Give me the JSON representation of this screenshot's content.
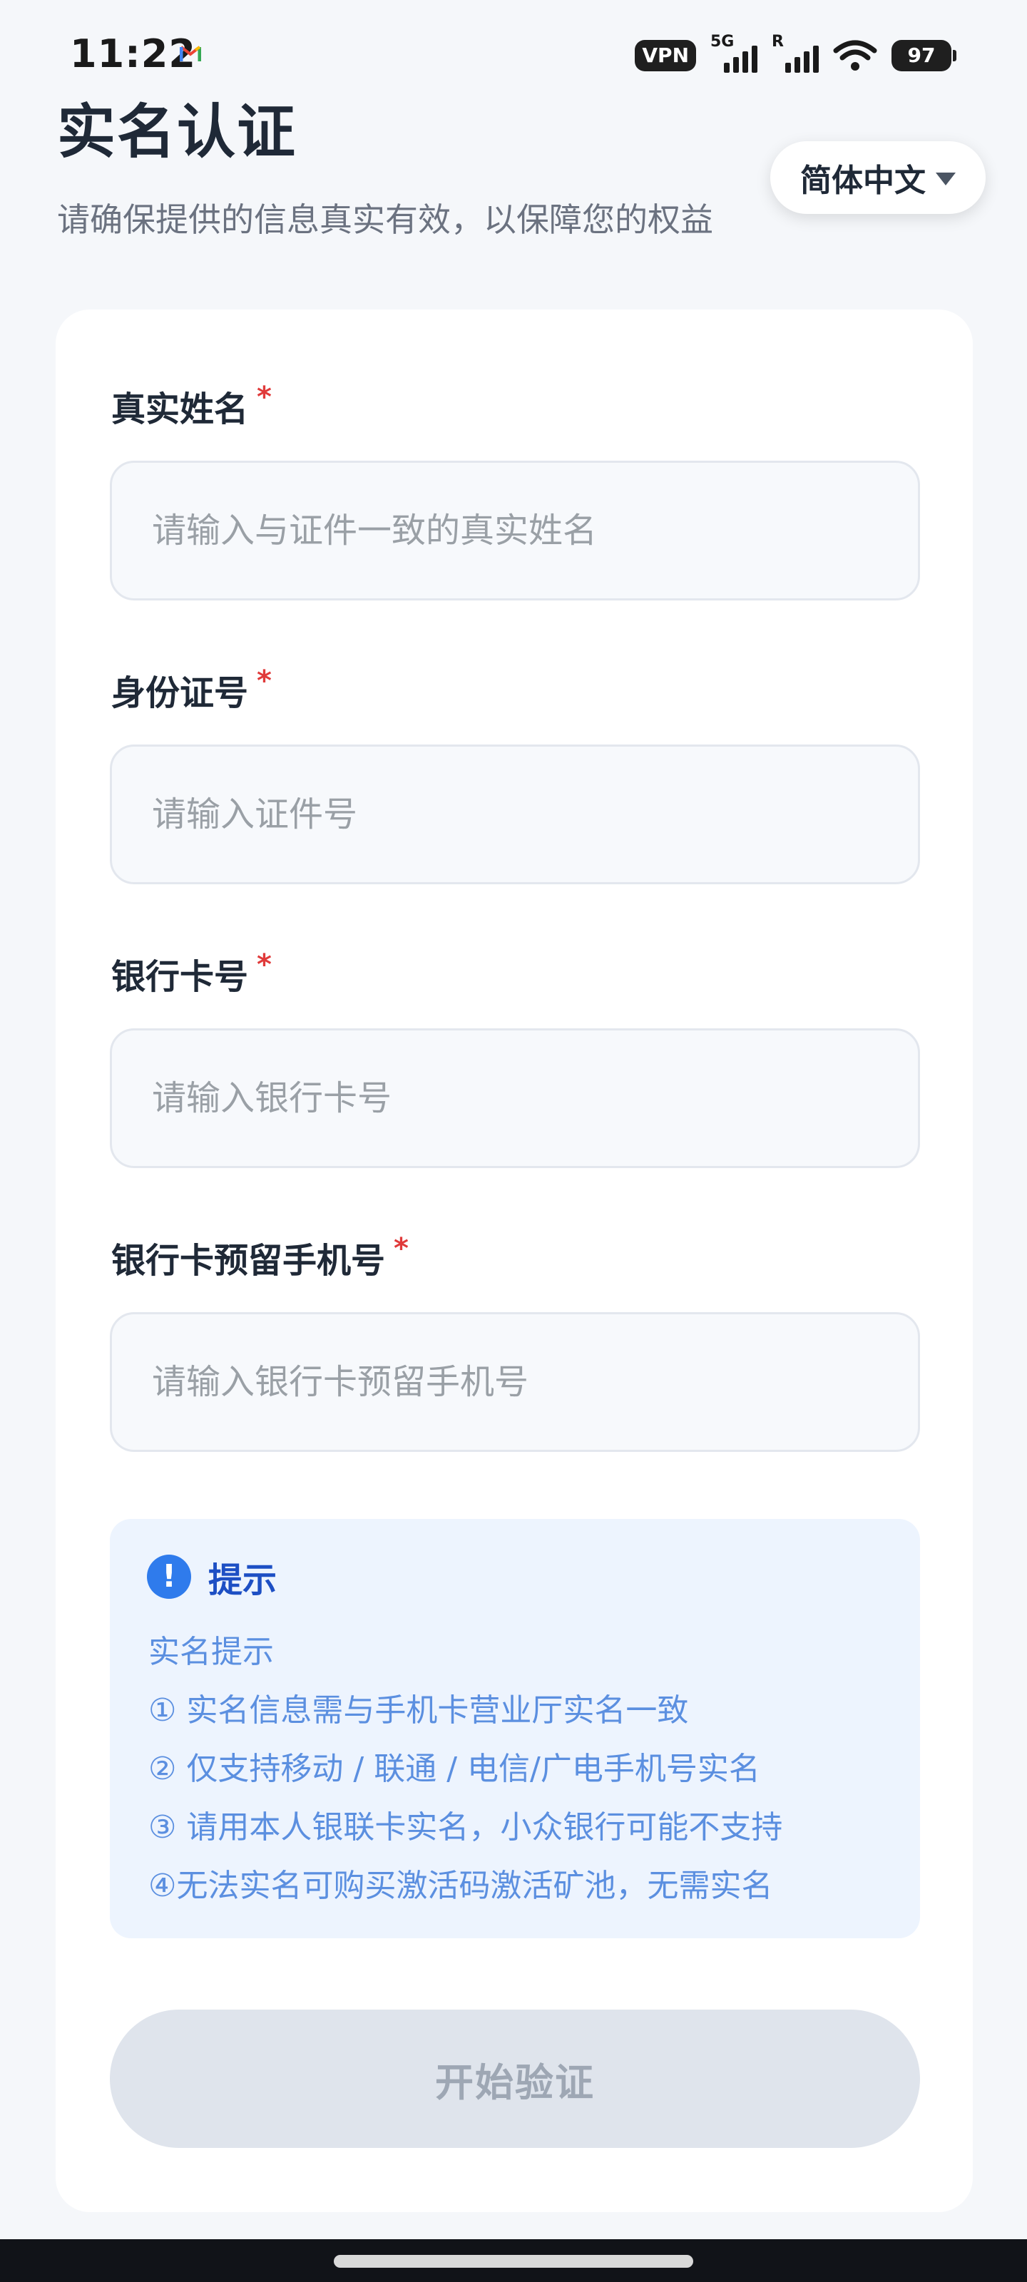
{
  "status_bar": {
    "time": "11:22",
    "vpn": "VPN",
    "signal1_tag": "5G",
    "signal2_tag": "R",
    "battery": "97"
  },
  "header": {
    "title": "实名认证",
    "subtitle": "请确保提供的信息真实有效，以保障您的权益",
    "language": "简体中文"
  },
  "form": {
    "required_mark": "*",
    "fields": [
      {
        "label": "真实姓名",
        "placeholder": "请输入与证件一致的真实姓名",
        "value": ""
      },
      {
        "label": "身份证号",
        "placeholder": "请输入证件号",
        "value": ""
      },
      {
        "label": "银行卡号",
        "placeholder": "请输入银行卡号",
        "value": ""
      },
      {
        "label": "银行卡预留手机号",
        "placeholder": "请输入银行卡预留手机号",
        "value": ""
      }
    ]
  },
  "tip": {
    "icon": "!",
    "title": "提示",
    "lines": [
      "实名提示",
      "① 实名信息需与手机卡营业厅实名一致",
      "② 仅支持移动 / 联通 / 电信/广电手机号实名",
      "③ 请用本人银联卡实名，小众银行可能不支持",
      "④无法实名可购买激活码激活矿池，无需实名"
    ]
  },
  "submit_label": "开始验证",
  "colors": {
    "background": "#f5f7fa",
    "card": "#ffffff",
    "required": "#e03a3a",
    "tip_background": "#edf4fe",
    "tip_icon": "#2f7bec",
    "tip_title": "#1d4fc4",
    "tip_text": "#5b8fe0",
    "button_disabled": "#dfe4ec"
  },
  "icons": {
    "app_notification": "gmail-icon",
    "signal": "signal-bars-icon",
    "wifi": "wifi-icon",
    "battery": "battery-icon",
    "language_caret": "caret-down-icon",
    "tip": "exclamation-circle-icon"
  }
}
